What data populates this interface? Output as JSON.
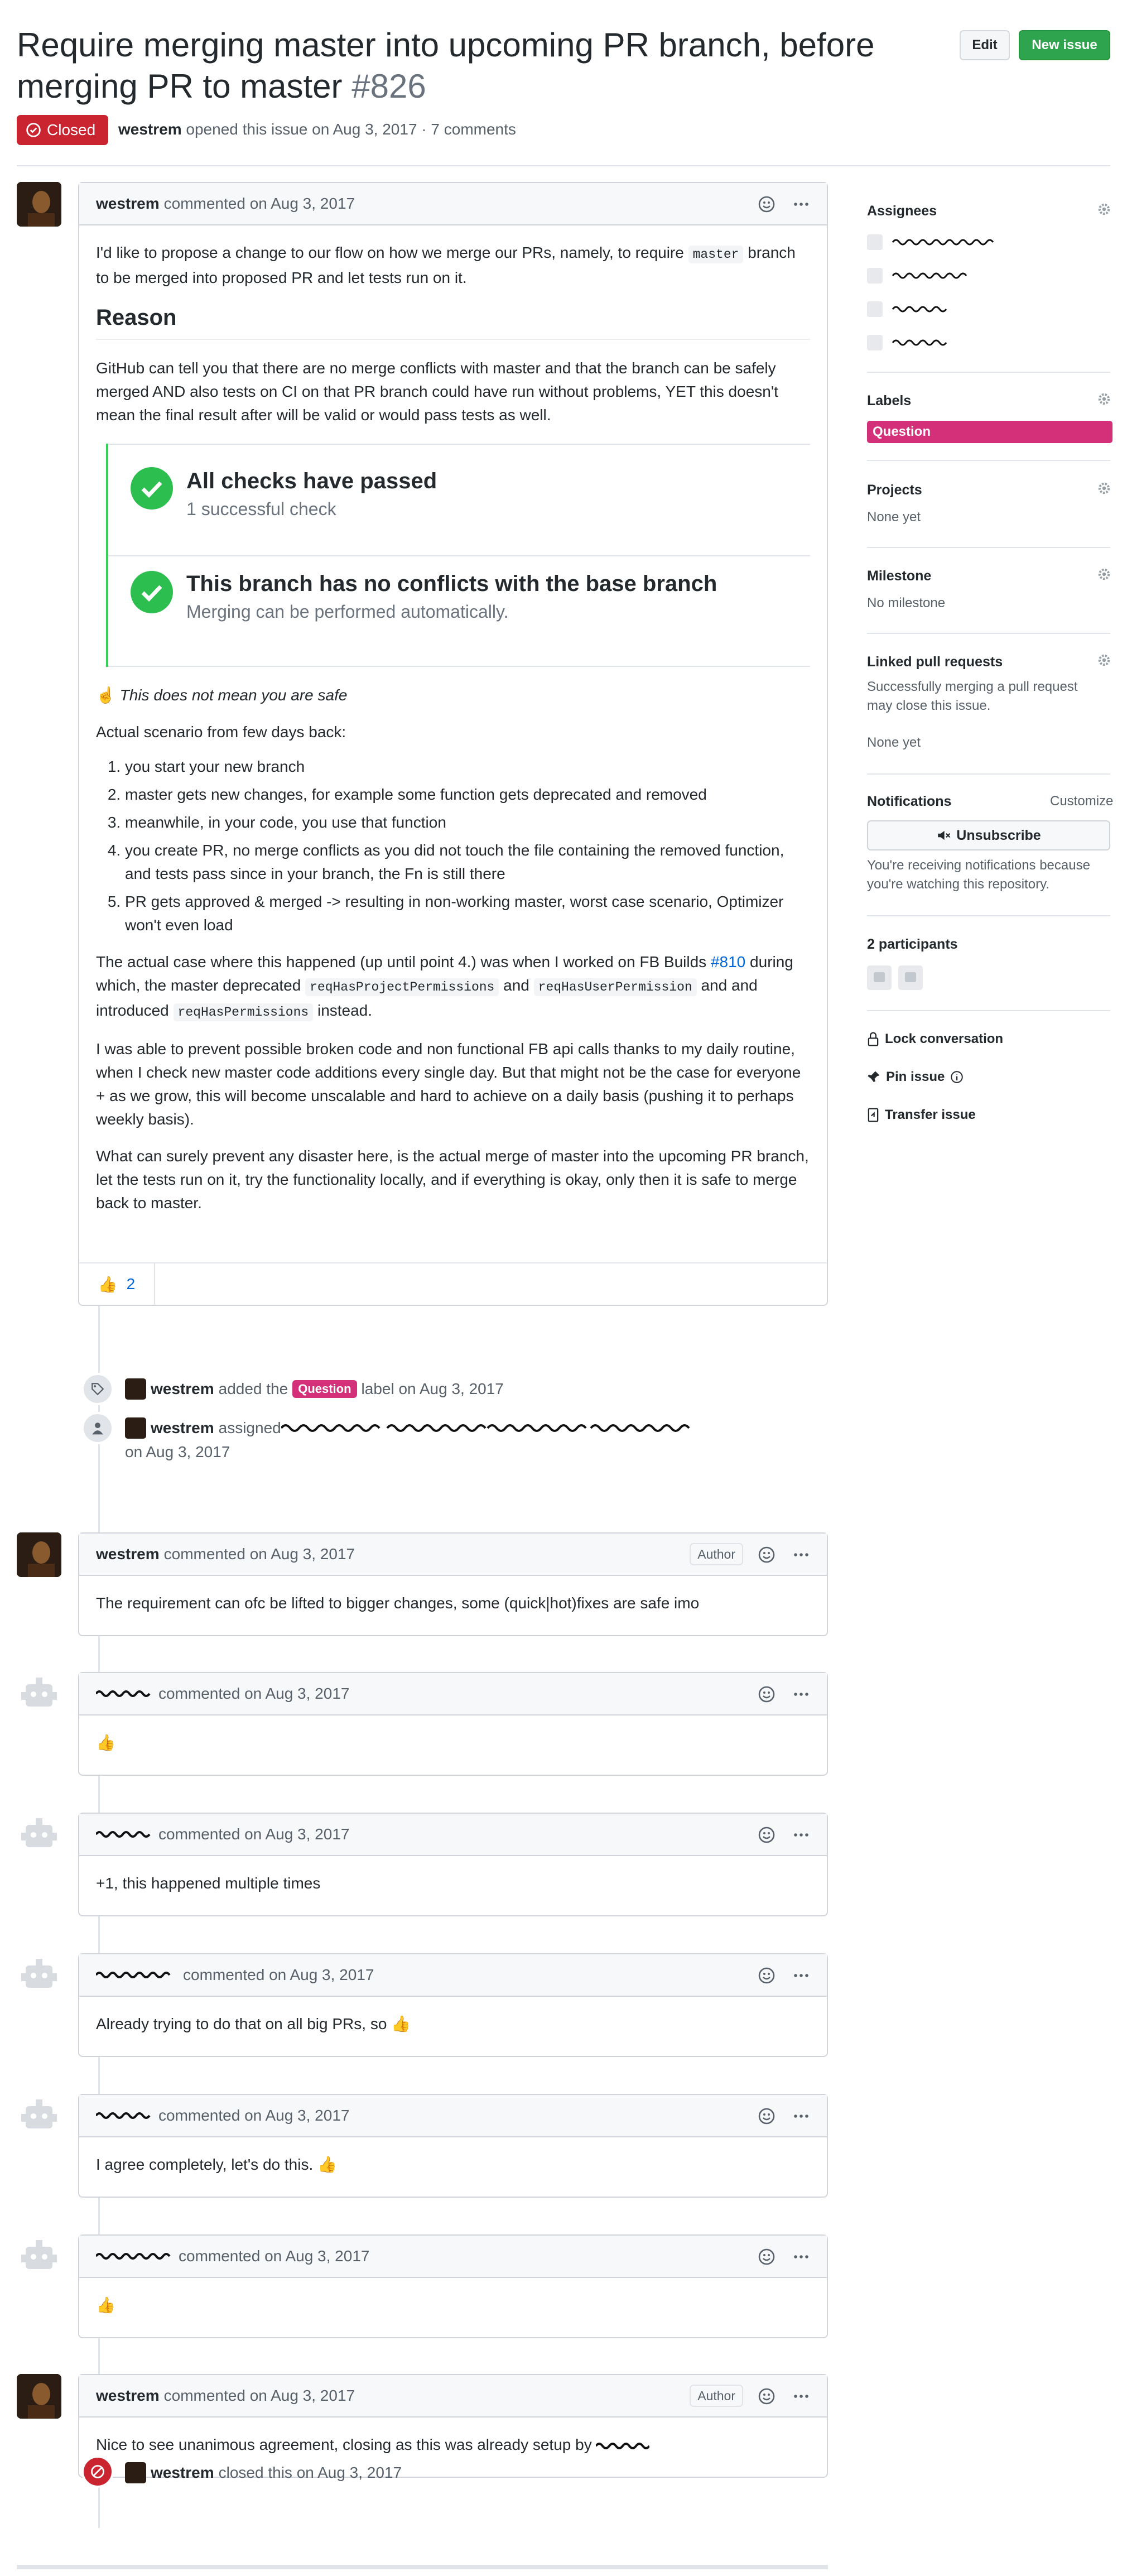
{
  "issue": {
    "title": "Require merging master into upcoming PR branch, before merging PR to master",
    "number": "#826",
    "status": "Closed",
    "author": "westrem",
    "opened_text": "opened this issue on Aug 3, 2017 · 7 comments"
  },
  "header": {
    "edit_label": "Edit",
    "new_issue_label": "New issue"
  },
  "first_comment": {
    "author": "westrem",
    "meta": "commented on Aug 3, 2017",
    "p1_a": "I'd like to propose a change to our flow on how we merge our PRs, namely, to require",
    "p1_code": "master",
    "p1_b": "branch to be merged into proposed PR and let tests run on it.",
    "heading": "Reason",
    "p2": "GitHub can tell you that there are no merge conflicts with master and that the branch can be safely merged AND also tests on CI on that PR branch could have run without problems, YET this doesn't mean the final result after will be valid or would pass tests as well.",
    "check1_title": "All checks have passed",
    "check1_sub": "1 successful check",
    "check2_title": "This branch has no conflicts with the base branch",
    "check2_sub": "Merging can be performed automatically.",
    "note": "This does not mean you are safe",
    "scenario_intro": "Actual scenario from few days back:",
    "list": [
      "you start your new branch",
      "master gets new changes, for example some function gets deprecated and removed",
      "meanwhile, in your code, you use that function",
      "you create PR, no merge conflicts as you did not touch the file containing the removed function, and tests pass since in your branch, the Fn is still there",
      "PR gets approved & merged -> resulting in non-working master, worst case scenario, Optimizer won't even load"
    ],
    "p3_a": "The actual case where this happened (up until point 4.) was when I worked on FB Builds",
    "p3_link": "#810",
    "p3_b": "during which, the master deprecated",
    "p3_code1": "reqHasProjectPermissions",
    "p3_and": "and",
    "p3_code2": "reqHasUserPermission",
    "p3_c": "and introduced",
    "p3_code3": "reqHasPermissions",
    "p3_d": "instead.",
    "p4": "I was able to prevent possible broken code and non functional FB api calls thanks to my daily routine, when I check new master code additions every single day. But that might not be the case for everyone + as we grow, this will become unscalable and hard to achieve on a daily basis (pushing it to perhaps weekly basis).",
    "p5": "What can surely prevent any disaster here, is the actual merge of master into the upcoming PR branch, let the tests run on it, try the functionality locally, and if everything is okay, only then it is safe to merge back to master.",
    "reaction_emoji": "👍",
    "reaction_count": "2"
  },
  "events": {
    "label_actor": "westrem",
    "label_text_a": "added the",
    "label_name": "Question",
    "label_text_b": "label on Aug 3, 2017",
    "assign_actor": "westrem",
    "assign_text": "assigned",
    "assign_date": "on Aug 3, 2017",
    "closed_actor": "westrem",
    "closed_text": "closed this on Aug 3, 2017"
  },
  "comments": [
    {
      "author": "westrem",
      "meta": "commented on Aug 3, 2017",
      "author_tag": "Author",
      "body": "The requirement can ofc be lifted to bigger changes, some (quick|hot)fixes are safe imo"
    },
    {
      "author": "",
      "meta": "commented on Aug 3, 2017",
      "body": "👍"
    },
    {
      "author": "",
      "meta": "commented on Aug 3, 2017",
      "body": "+1, this happened multiple times"
    },
    {
      "author": "",
      "meta": "commented on Aug 3, 2017",
      "body": "Already trying to do that on all big PRs, so 👍"
    },
    {
      "author": "",
      "meta": "commented on Aug 3, 2017",
      "body": "I agree completely, let's do this. 👍"
    },
    {
      "author": "",
      "meta": "commented on Aug 3, 2017",
      "body": "👍"
    },
    {
      "author": "westrem",
      "meta": "commented on Aug 3, 2017",
      "author_tag": "Author",
      "body": "Nice to see unanimous agreement, closing as this was already setup by"
    }
  ],
  "sidebar": {
    "assignees_title": "Assignees",
    "labels_title": "Labels",
    "label_question": "Question",
    "label_color": "#d4307a",
    "projects_title": "Projects",
    "projects_value": "None yet",
    "milestone_title": "Milestone",
    "milestone_value": "No milestone",
    "linked_title": "Linked pull requests",
    "linked_desc": "Successfully merging a pull request may close this issue.",
    "linked_value": "None yet",
    "notifications_title": "Notifications",
    "customize": "Customize",
    "unsubscribe": "Unsubscribe",
    "notif_desc": "You're receiving notifications because you're watching this repository.",
    "participants": "2 participants",
    "lock": "Lock conversation",
    "pin": "Pin issue",
    "transfer": "Transfer issue"
  },
  "colors": {
    "closed": "#cb2431",
    "new_issue": "#2ea44f",
    "link": "#0366d6",
    "check_green": "#2cbe4e"
  }
}
